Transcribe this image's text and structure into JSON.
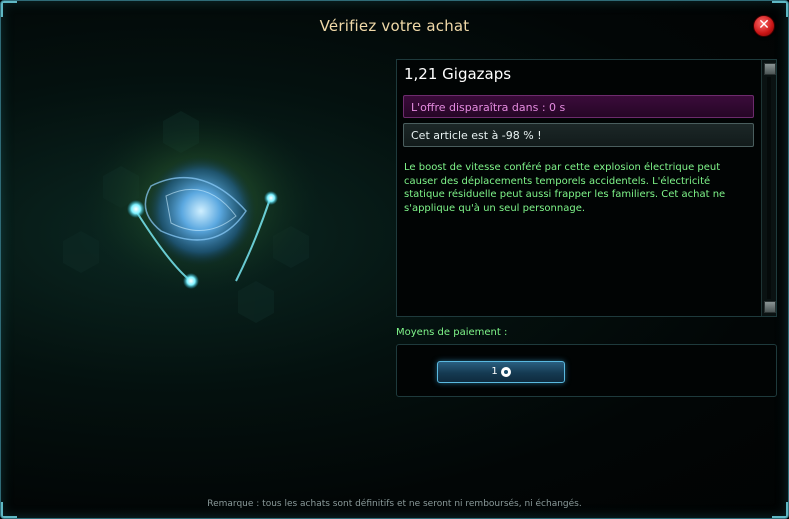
{
  "dialog": {
    "title": "Vérifiez votre achat",
    "close_symbol": "✕"
  },
  "product": {
    "name": "1,21 Gigazaps",
    "offer_text": "L'offre disparaîtra dans : 0 s",
    "discount_text": "Cet article est à -98 % !",
    "description": "Le boost de vitesse conféré par cette explosion électrique peut causer des déplacements temporels accidentels. L'électricité statique résiduelle peut aussi frapper les familiers. Cet achat ne s'applique qu'à un seul personnage."
  },
  "payment": {
    "label": "Moyens de paiement :",
    "price": "1",
    "currency_icon": "zen-coin-icon"
  },
  "footer": {
    "note": "Remarque : tous les achats sont définitifs et ne seront ni remboursés, ni échangés."
  },
  "colors": {
    "title": "#f0d9a8",
    "description_text": "#7ff58a",
    "offer_bar": "#3a0b3a",
    "accent_border": "#2f6b77",
    "close_button": "#c81414"
  }
}
